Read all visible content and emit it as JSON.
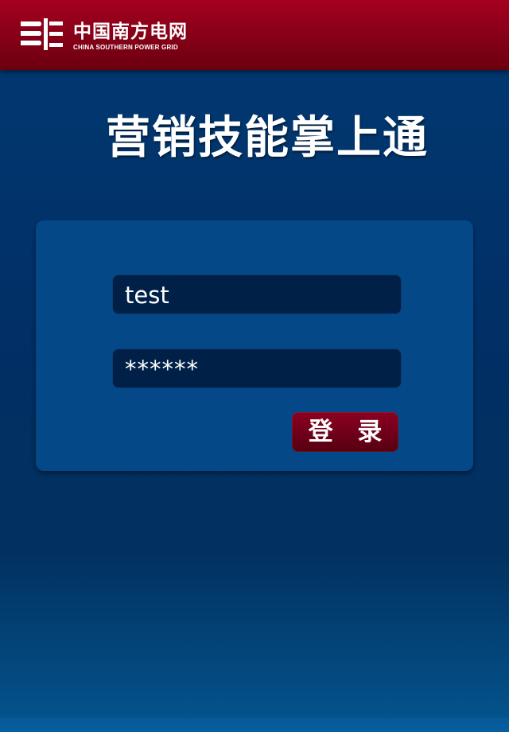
{
  "header": {
    "logo_cn": "中国南方电网",
    "logo_en": "CHINA SOUTHERN POWER GRID",
    "logo_icon": "power-grid-logo-icon"
  },
  "app_title": "营销技能掌上通",
  "login_form": {
    "username_value": "test",
    "password_display": "******",
    "login_button_label": "登 录"
  },
  "colors": {
    "header_red": "#8d0019",
    "background_blue": "#013a72",
    "panel_blue": "#044888",
    "field_navy": "#012048",
    "button_red": "#71001a"
  }
}
